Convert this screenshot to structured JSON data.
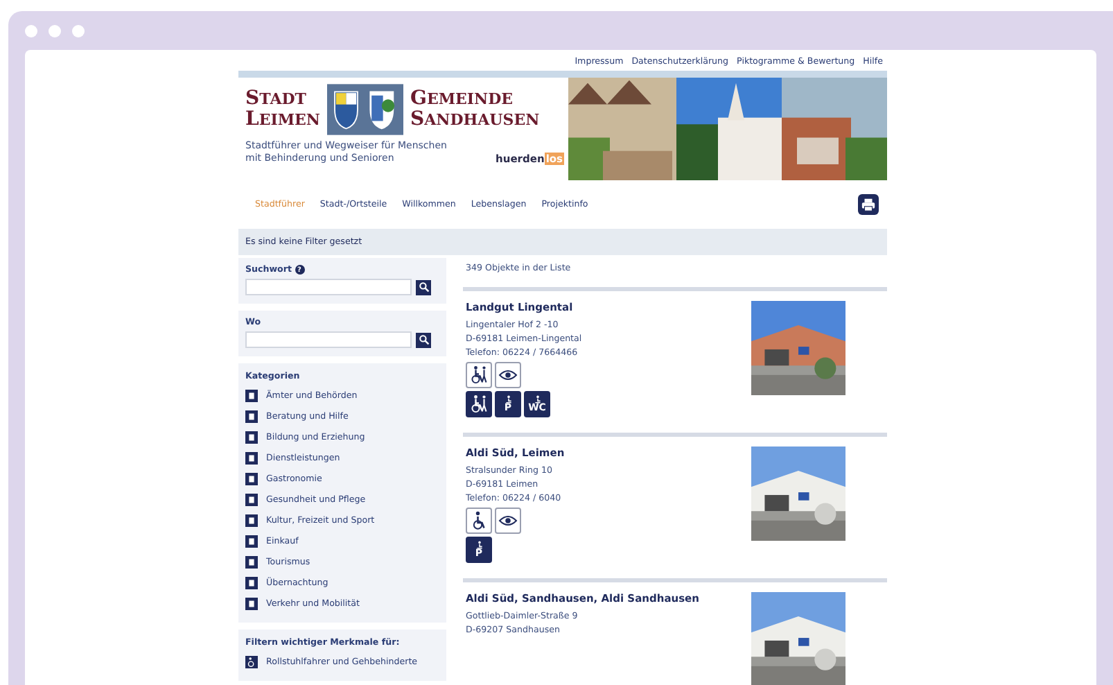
{
  "top_links": [
    "Impressum",
    "Datenschutzerklärung",
    "Piktogramme & Bewertung",
    "Hilfe"
  ],
  "header": {
    "city": [
      "STADT",
      "LEIMEN"
    ],
    "municipality": [
      "GEMEINDE",
      "SANDHAUSEN"
    ],
    "tagline": "Stadtführer und Wegweiser für Menschen mit Behinderung und Senioren",
    "brand": "huerden",
    "brand_suffix": "los"
  },
  "nav": [
    {
      "label": "Stadtführer",
      "selected": true
    },
    {
      "label": "Stadt-/Ortsteile",
      "selected": false
    },
    {
      "label": "Willkommen",
      "selected": false
    },
    {
      "label": "Lebenslagen",
      "selected": false
    },
    {
      "label": "Projektinfo",
      "selected": false
    }
  ],
  "filter_notice": "Es sind keine Filter gesetzt",
  "search": {
    "label": "Suchwort",
    "help": "?"
  },
  "where": {
    "label": "Wo"
  },
  "categories": {
    "title": "Kategorien",
    "items": [
      "Ämter und Behörden",
      "Beratung und Hilfe",
      "Bildung und Erziehung",
      "Dienstleistungen",
      "Gastronomie",
      "Gesundheit und Pflege",
      "Kultur, Freizeit und Sport",
      "Einkauf",
      "Tourismus",
      "Übernachtung",
      "Verkehr und Mobilität"
    ]
  },
  "features": {
    "title": "Filtern wichtiger Merkmale für:",
    "items": [
      "Rollstuhlfahrer und Gehbehinderte"
    ]
  },
  "result_count": "349 Objekte in der Liste",
  "listings": [
    {
      "name": "Landgut Lingental",
      "lines": [
        "Lingentaler Hof 2 -10",
        "D-69181 Leimen-Lingental",
        "Telefon: 06224 / 7664466"
      ],
      "pictogram_rows": [
        [
          {
            "kind": "walker",
            "filled": false
          },
          {
            "kind": "eye",
            "filled": false
          }
        ],
        [
          {
            "kind": "walker",
            "filled": true
          },
          {
            "kind": "parking",
            "filled": true,
            "label": "P"
          },
          {
            "kind": "toilet",
            "filled": true,
            "label": "WC"
          }
        ]
      ]
    },
    {
      "name": "Aldi Süd, Leimen",
      "lines": [
        "Stralsunder Ring 10",
        "D-69181 Leimen",
        "Telefon: 06224 / 6040"
      ],
      "pictogram_rows": [
        [
          {
            "kind": "wheelchair",
            "filled": false
          },
          {
            "kind": "eye",
            "filled": false
          }
        ],
        [
          {
            "kind": "parking",
            "filled": true,
            "label": "P"
          }
        ]
      ]
    },
    {
      "name": "Aldi Süd, Sandhausen, Aldi Sandhausen",
      "lines": [
        "Gottlieb-Daimler-Straße 9",
        "D-69207 Sandhausen"
      ]
    }
  ]
}
